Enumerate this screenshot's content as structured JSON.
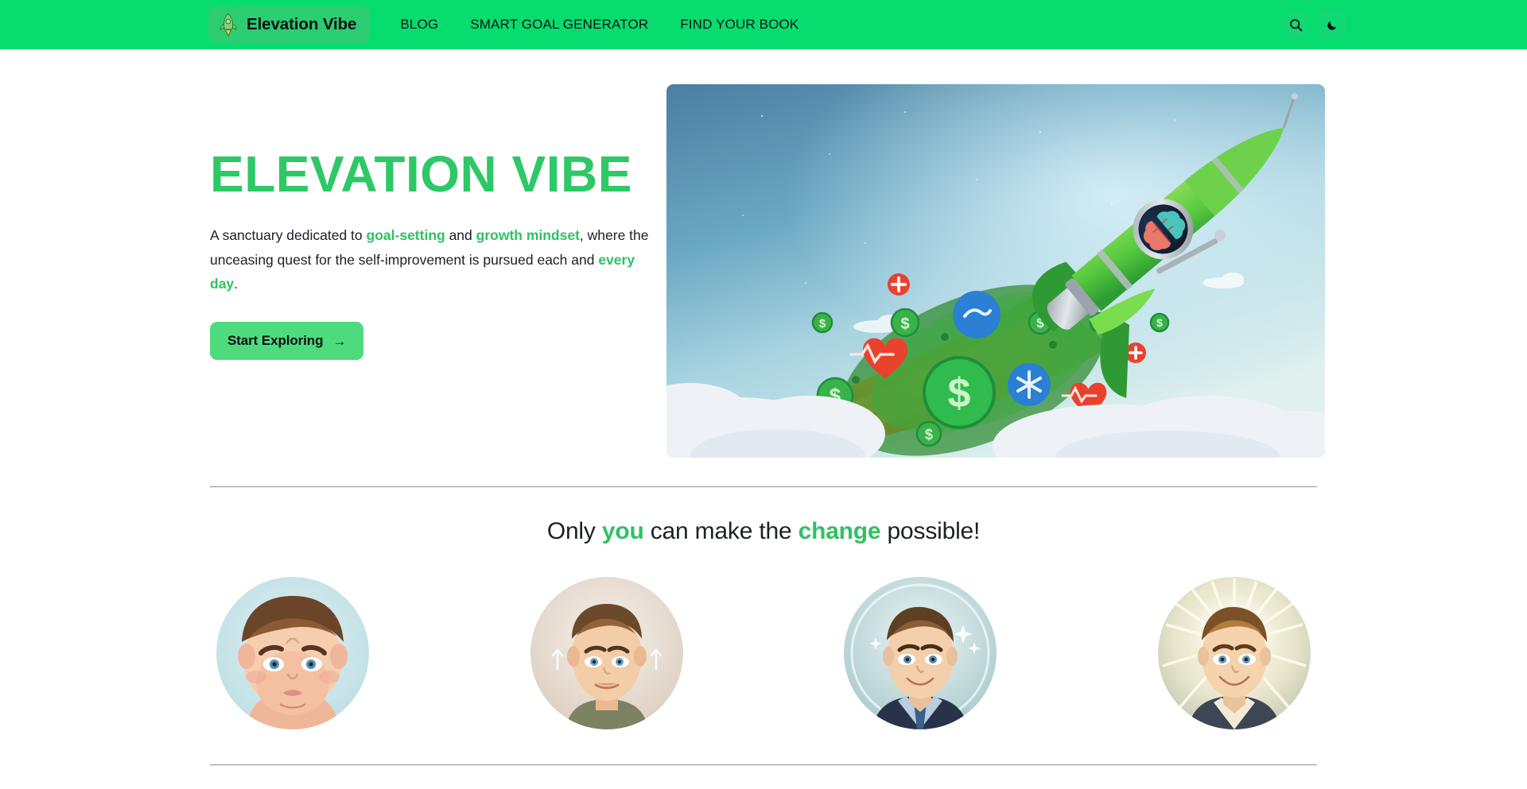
{
  "navbar": {
    "brand": {
      "label": "Elevation Vibe",
      "icon": "rocket-icon"
    },
    "links": [
      {
        "label": "BLOG"
      },
      {
        "label": "SMART GOAL GENERATOR"
      },
      {
        "label": "FIND YOUR BOOK"
      }
    ],
    "actions": [
      {
        "name": "search-icon",
        "label": "Search"
      },
      {
        "name": "dark-mode-moon-icon",
        "label": "Toggle dark mode"
      }
    ],
    "colors": {
      "background": "#06dd6e",
      "brand_pill": "#2ccc71"
    }
  },
  "hero": {
    "title": "ELEVATION VIBE",
    "paragraph": {
      "part1": "A sanctuary dedicated to ",
      "link1": "goal-setting",
      "part2": " and ",
      "link2": "growth mindset",
      "part3": ", where the unceasing quest for the self-improvement is pursued each and ",
      "link3": "every day",
      "part4": "."
    },
    "cta": {
      "label": "Start Exploring",
      "arrow": "→"
    },
    "image_alt": "Green rocket with a brain in its porthole launching through clouds trailed by a cloud of dollar, heart and medical-cross icons"
  },
  "change_section": {
    "title": {
      "part1": "Only ",
      "hl1": "you",
      "part2": " can make the ",
      "hl2": "change",
      "part3": " possible!"
    },
    "avatars": [
      {
        "name": "avatar-sad-overweight-man",
        "alt": "Sad overweight man on pale blue background"
      },
      {
        "name": "avatar-fit-man-arrows",
        "alt": "Fit young man with upward arrows on beige background"
      },
      {
        "name": "avatar-confident-man-suit",
        "alt": "Confident smiling man in suit with sparkles on teal background"
      },
      {
        "name": "avatar-radiant-successful-man",
        "alt": "Radiant successful man in suit with golden rays"
      }
    ]
  },
  "theme": {
    "accent_green": "#2fc163",
    "nav_green": "#06dd6e",
    "cta_green": "#4ddb7e",
    "text_dark": "#1d2026",
    "divider": "#e2e4e7"
  }
}
